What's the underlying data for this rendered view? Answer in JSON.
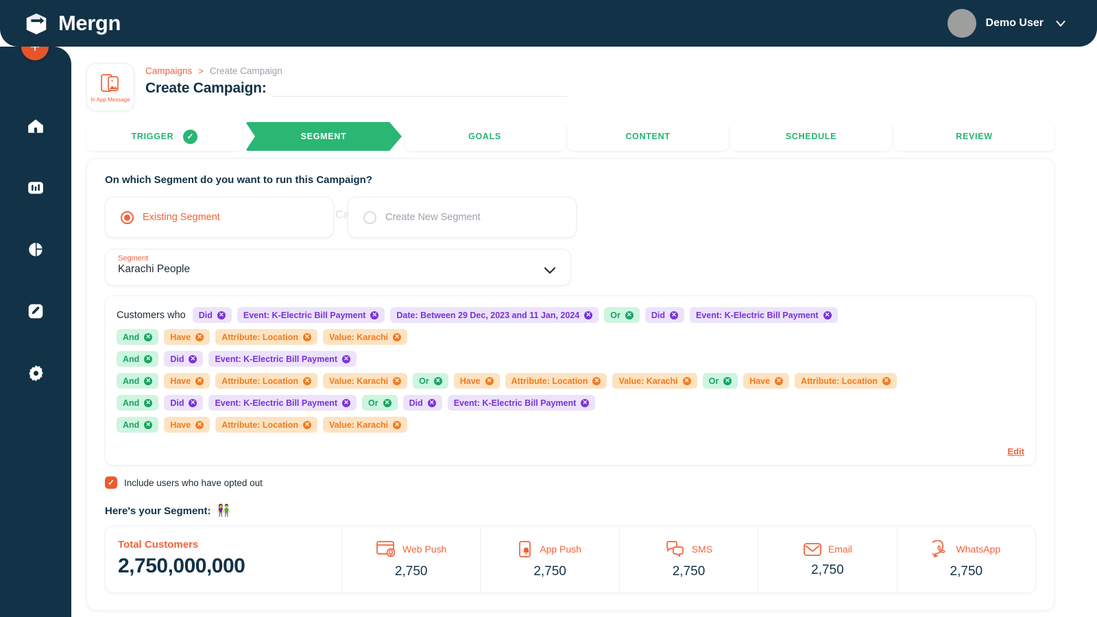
{
  "app": {
    "brand_name": "Mergn",
    "logo_icon": "mergn-cube-logo"
  },
  "topbar": {
    "user_name": "Demo User",
    "avatar_icon": "user-avatar",
    "chevron_icon": "chevron-down-icon"
  },
  "sidebar": {
    "fab": {
      "label": "+",
      "icon": "plus-icon"
    },
    "items": [
      {
        "icon": "home-icon",
        "name": "home"
      },
      {
        "icon": "bar-chart-icon",
        "name": "analytics"
      },
      {
        "icon": "pie-chart-icon",
        "name": "reports"
      },
      {
        "icon": "pen-icon",
        "name": "campaigns"
      },
      {
        "icon": "gear-icon",
        "name": "settings"
      }
    ]
  },
  "header": {
    "type_card": {
      "label": "In App Message",
      "icon": "in-app-message-icon"
    },
    "breadcrumb": {
      "parent": "Campaigns",
      "separator": ">",
      "current": "Create Campaign"
    },
    "page_title": "Create Campaign:",
    "campaign_name_value": "",
    "campaign_name_placeholder": ""
  },
  "stepper": {
    "steps": [
      {
        "label": "TRIGGER",
        "state": "done"
      },
      {
        "label": "SEGMENT",
        "state": "active"
      },
      {
        "label": "GOALS",
        "state": "upcoming"
      },
      {
        "label": "CONTENT",
        "state": "upcoming"
      },
      {
        "label": "SCHEDULE",
        "state": "upcoming"
      },
      {
        "label": "REVIEW",
        "state": "upcoming"
      }
    ],
    "done_check": "✓"
  },
  "segment": {
    "question": "On which Segment do you want to run this Campaign?",
    "ghost_text": "Ca",
    "options": [
      {
        "label": "Existing Segment",
        "selected": true
      },
      {
        "label": "Create New Segment",
        "selected": false
      }
    ],
    "select": {
      "caption": "Segment",
      "value": "Karachi People",
      "chevron_icon": "chevron-down-icon"
    },
    "conditions": {
      "prefix": "Customers who",
      "edit_label": "Edit",
      "rows": [
        [
          {
            "text": "Did",
            "color": "purple"
          },
          {
            "text": "Event: K-Electric Bill Payment",
            "color": "purple"
          },
          {
            "text": "Date: Between 29 Dec, 2023 and 11 Jan, 2024",
            "color": "purple"
          },
          {
            "text": "Or",
            "color": "green"
          },
          {
            "text": "Did",
            "color": "purple"
          },
          {
            "text": "Event: K-Electric Bill Payment",
            "color": "purple"
          }
        ],
        [
          {
            "text": "And",
            "color": "green"
          },
          {
            "text": "Have",
            "color": "orange"
          },
          {
            "text": "Attribute: Location",
            "color": "orange"
          },
          {
            "text": "Value: Karachi",
            "color": "orange"
          }
        ],
        [
          {
            "text": "And",
            "color": "green"
          },
          {
            "text": "Did",
            "color": "purple"
          },
          {
            "text": "Event: K-Electric Bill Payment",
            "color": "purple"
          }
        ],
        [
          {
            "text": "And",
            "color": "green"
          },
          {
            "text": "Have",
            "color": "orange"
          },
          {
            "text": "Attribute: Location",
            "color": "orange"
          },
          {
            "text": "Value: Karachi",
            "color": "orange"
          },
          {
            "text": "Or",
            "color": "green"
          },
          {
            "text": "Have",
            "color": "orange"
          },
          {
            "text": "Attribute: Location",
            "color": "orange"
          },
          {
            "text": "Value: Karachi",
            "color": "orange"
          },
          {
            "text": "Or",
            "color": "green"
          },
          {
            "text": "Have",
            "color": "orange"
          },
          {
            "text": "Attribute: Location",
            "color": "orange"
          }
        ],
        [
          {
            "text": "And",
            "color": "green"
          },
          {
            "text": "Did",
            "color": "purple"
          },
          {
            "text": "Event: K-Electric Bill Payment",
            "color": "purple"
          },
          {
            "text": "Or",
            "color": "green"
          },
          {
            "text": "Did",
            "color": "purple"
          },
          {
            "text": "Event: K-Electric Bill Payment",
            "color": "purple"
          }
        ],
        [
          {
            "text": "And",
            "color": "green"
          },
          {
            "text": "Have",
            "color": "orange"
          },
          {
            "text": "Attribute: Location",
            "color": "orange"
          },
          {
            "text": "Value: Karachi",
            "color": "orange"
          }
        ]
      ]
    },
    "opted_out": {
      "label": "Include users who have opted out",
      "checked": true,
      "check_glyph": "✓"
    },
    "result": {
      "heading": "Here's your Segment:",
      "emoji": "👫",
      "total": {
        "caption": "Total Customers",
        "value": "2,750,000,000"
      },
      "channels": [
        {
          "name": "Web Push",
          "value": "2,750",
          "icon": "web-push-icon"
        },
        {
          "name": "App Push",
          "value": "2,750",
          "icon": "app-push-icon"
        },
        {
          "name": "SMS",
          "value": "2,750",
          "icon": "sms-icon"
        },
        {
          "name": "Email",
          "value": "2,750",
          "icon": "email-icon"
        },
        {
          "name": "WhatsApp",
          "value": "2,750",
          "icon": "whatsapp-icon"
        }
      ]
    }
  },
  "colors": {
    "navy": "#123247",
    "orange": "#f0623a",
    "green": "#2bb673",
    "purple_chip_bg": "#ece3fb",
    "purple_chip_fg": "#7a32d8",
    "green_chip_bg": "#cdf5e0",
    "green_chip_fg": "#19a463",
    "orange_chip_bg": "#fde3c1",
    "orange_chip_fg": "#ef7c22"
  }
}
